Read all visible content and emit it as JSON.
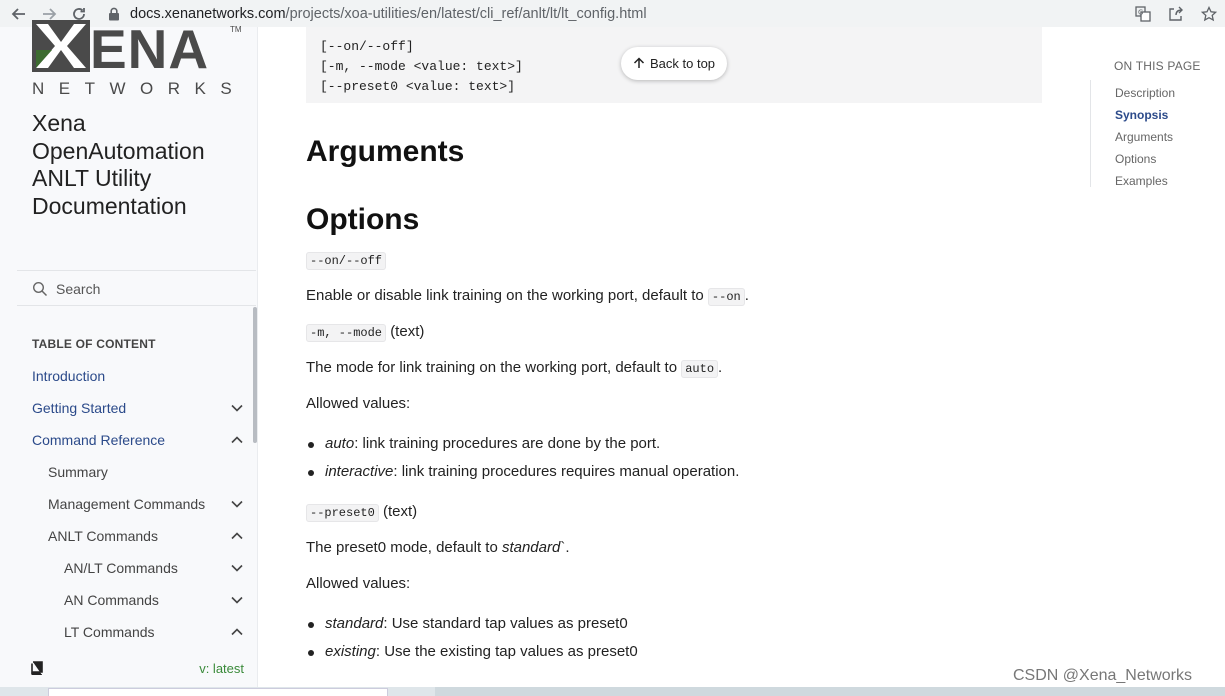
{
  "browser": {
    "url_host": "docs.xenanetworks.com",
    "url_path": "/projects/xoa-utilities/en/latest/cli_ref/anlt/lt/lt_config.html",
    "icons": [
      "back-icon",
      "forward-icon",
      "reload-icon",
      "lock-icon",
      "translate-icon",
      "share-icon",
      "star-icon"
    ]
  },
  "sidebar": {
    "logo_text": "XENA",
    "logo_sub": "NETWORKS",
    "logo_tm": "TM",
    "title": "Xena OpenAutomation ANLT Utility Documentation",
    "search_label": "Search",
    "toc_title": "TABLE OF CONTENT",
    "items": [
      {
        "label": "Introduction",
        "level": 1,
        "chevron": "none"
      },
      {
        "label": "Getting Started",
        "level": 1,
        "chevron": "down"
      },
      {
        "label": "Command Reference",
        "level": 1,
        "chevron": "up"
      },
      {
        "label": "Summary",
        "level": 2,
        "chevron": "none"
      },
      {
        "label": "Management Commands",
        "level": 2,
        "chevron": "down"
      },
      {
        "label": "ANLT Commands",
        "level": 2,
        "chevron": "up"
      },
      {
        "label": "AN/LT Commands",
        "level": 3,
        "chevron": "down"
      },
      {
        "label": "AN Commands",
        "level": 3,
        "chevron": "down"
      },
      {
        "label": "LT Commands",
        "level": 3,
        "chevron": "up"
      }
    ],
    "version": "v: latest"
  },
  "main": {
    "code_lines": [
      "[--on/--off]",
      "[-m, --mode <value: text>]",
      "[--preset0 <value: text>]"
    ],
    "back_to_top": "Back to top",
    "heading_arguments": "Arguments",
    "heading_options": "Options",
    "opt1": {
      "code": "--on/--off",
      "desc_prefix": "Enable or disable link training on the working port, default to ",
      "desc_code": "--on",
      "desc_suffix": "."
    },
    "opt2": {
      "code": "-m, --mode",
      "type": "(text)",
      "desc_prefix": "The mode for link training on the working port, default to ",
      "desc_code": "auto",
      "desc_suffix": ".",
      "allowed": "Allowed values:",
      "values": [
        {
          "name": "auto",
          "desc": ": link training procedures are done by the port."
        },
        {
          "name": "interactive",
          "desc": ": link training procedures requires manual operation."
        }
      ]
    },
    "opt3": {
      "code": "--preset0",
      "type": "(text)",
      "desc_prefix": "The preset0 mode, default to ",
      "desc_em": "standard",
      "desc_suffix": "`.",
      "allowed": "Allowed values:",
      "values": [
        {
          "name": "standard",
          "desc": ": Use standard tap values as preset0"
        },
        {
          "name": "existing",
          "desc": ": Use the existing tap values as preset0"
        }
      ]
    }
  },
  "on_this_page": {
    "title": "ON THIS PAGE",
    "items": [
      "Description",
      "Synopsis",
      "Arguments",
      "Options",
      "Examples"
    ],
    "active": "Synopsis"
  },
  "watermark": "CSDN @Xena_Networks",
  "colors": {
    "link": "#2b4a8a",
    "logo_green": "#3c6b2f",
    "logo_gray": "#4a4a4a",
    "version": "#3a8a3a"
  }
}
